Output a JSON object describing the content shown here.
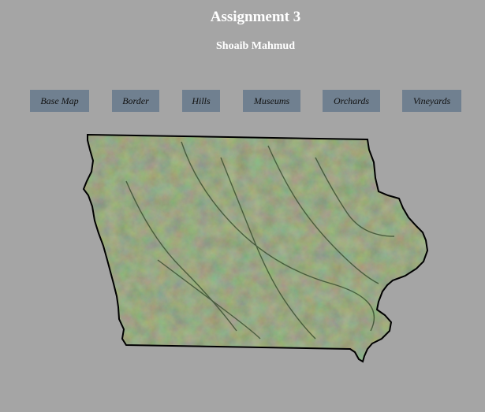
{
  "header": {
    "title": "Assignmemt 3",
    "author": "Shoaib Mahmud"
  },
  "toolbar": {
    "buttons": [
      {
        "id": "base-map",
        "label": "Base Map"
      },
      {
        "id": "border",
        "label": "Border"
      },
      {
        "id": "hills",
        "label": "Hills"
      },
      {
        "id": "museums",
        "label": "Museums"
      },
      {
        "id": "orchards",
        "label": "Orchards"
      },
      {
        "id": "vineyards",
        "label": "Vineyards"
      }
    ]
  },
  "map": {
    "basemap": "satellite imagery",
    "border_color": "#000000",
    "land_color": "#5c7046"
  },
  "colors": {
    "background": "#a5a5a5",
    "button": "#708090",
    "title_text": "#ffffff"
  }
}
